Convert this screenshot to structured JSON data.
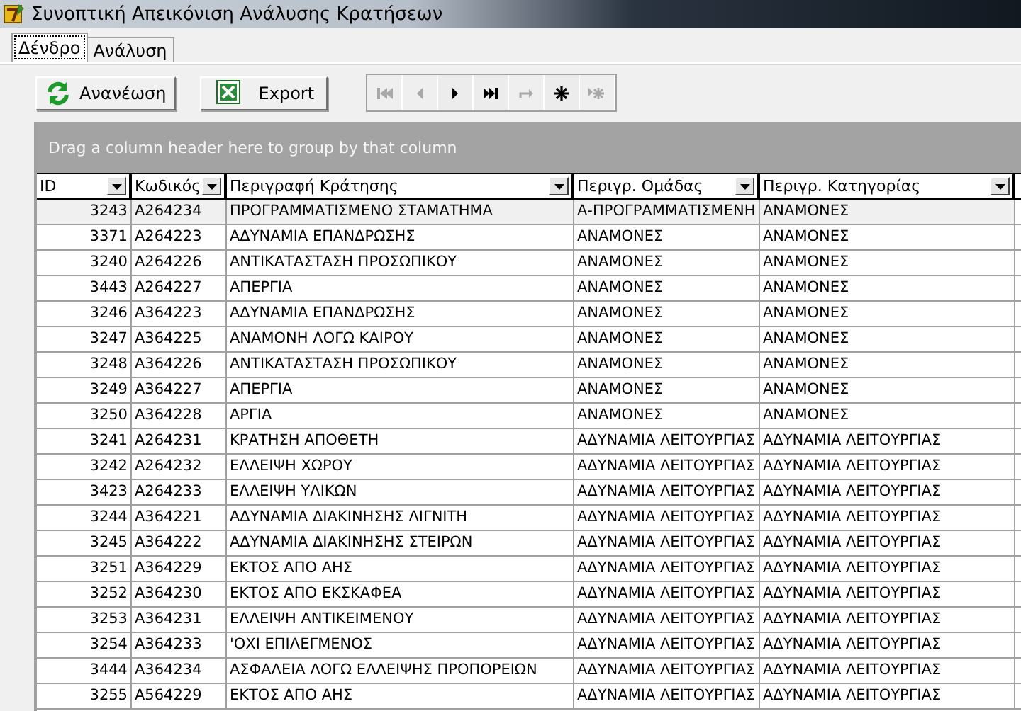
{
  "window": {
    "title": "Συνοπτική Απεικόνιση Ανάλυσης Κρατήσεων"
  },
  "tabs": [
    {
      "label": "Δένδρο",
      "selected": true
    },
    {
      "label": "Ανάλυση",
      "selected": false
    }
  ],
  "toolbar": {
    "buttons": [
      {
        "kind": "refresh",
        "label": "Ανανέωση"
      },
      {
        "kind": "export",
        "label": "Export"
      }
    ],
    "navigator": [
      {
        "kind": "first",
        "disabled": true
      },
      {
        "kind": "prev",
        "disabled": true
      },
      {
        "kind": "next",
        "disabled": false
      },
      {
        "kind": "last",
        "disabled": false
      },
      {
        "kind": "refresh",
        "disabled": true
      },
      {
        "kind": "insert",
        "disabled": false
      },
      {
        "kind": "post",
        "disabled": true
      }
    ]
  },
  "grid": {
    "group_hint": "Drag a column header here to group by that column",
    "columns": [
      "ID",
      "Κωδικός",
      "Περιγραφή Κράτησης",
      "Περιγρ. Ομάδας",
      "Περιγρ. Κατηγορίας"
    ],
    "rows": [
      {
        "selected": true,
        "cells": [
          "3243",
          "A264234",
          "ΠΡΟΓΡΑΜΜΑΤΙΣΜΕΝΟ ΣΤΑΜΑΤΗΜΑ",
          "Α-ΠΡΟΓΡΑΜΜΑΤΙΣΜΕΝΗ",
          "ΑΝΑΜΟΝΕΣ"
        ]
      },
      {
        "selected": false,
        "cells": [
          "3371",
          "A264223",
          "ΑΔΥΝΑΜΙΑ ΕΠΑΝΔΡΩΣΗΣ",
          "ΑΝΑΜΟΝΕΣ",
          "ΑΝΑΜΟΝΕΣ"
        ]
      },
      {
        "selected": false,
        "cells": [
          "3240",
          "A264226",
          "ΑΝΤΙΚΑΤΑΣΤΑΣΗ ΠΡΟΣΩΠΙΚΟΥ",
          "ΑΝΑΜΟΝΕΣ",
          "ΑΝΑΜΟΝΕΣ"
        ]
      },
      {
        "selected": false,
        "cells": [
          "3443",
          "A264227",
          "ΑΠΕΡΓΙΑ",
          "ΑΝΑΜΟΝΕΣ",
          "ΑΝΑΜΟΝΕΣ"
        ]
      },
      {
        "selected": false,
        "cells": [
          "3246",
          "A364223",
          "ΑΔΥΝΑΜΙΑ ΕΠΑΝΔΡΩΣΗΣ",
          "ΑΝΑΜΟΝΕΣ",
          "ΑΝΑΜΟΝΕΣ"
        ]
      },
      {
        "selected": false,
        "cells": [
          "3247",
          "A364225",
          "ΑΝΑΜΟΝΗ ΛΟΓΩ ΚΑΙΡΟΥ",
          "ΑΝΑΜΟΝΕΣ",
          "ΑΝΑΜΟΝΕΣ"
        ]
      },
      {
        "selected": false,
        "cells": [
          "3248",
          "A364226",
          "ΑΝΤΙΚΑΤΑΣΤΑΣΗ ΠΡΟΣΩΠΙΚΟΥ",
          "ΑΝΑΜΟΝΕΣ",
          "ΑΝΑΜΟΝΕΣ"
        ]
      },
      {
        "selected": false,
        "cells": [
          "3249",
          "A364227",
          "ΑΠΕΡΓΙΑ",
          "ΑΝΑΜΟΝΕΣ",
          "ΑΝΑΜΟΝΕΣ"
        ]
      },
      {
        "selected": false,
        "cells": [
          "3250",
          "A364228",
          "ΑΡΓΙΑ",
          "ΑΝΑΜΟΝΕΣ",
          "ΑΝΑΜΟΝΕΣ"
        ]
      },
      {
        "selected": false,
        "cells": [
          "3241",
          "A264231",
          "ΚΡΑΤΗΣΗ ΑΠΟΘΕΤΗ",
          "ΑΔΥΝΑΜΙΑ ΛΕΙΤΟΥΡΓΙΑΣ",
          "ΑΔΥΝΑΜΙΑ ΛΕΙΤΟΥΡΓΙΑΣ"
        ]
      },
      {
        "selected": false,
        "cells": [
          "3242",
          "A264232",
          "ΕΛΛΕΙΨΗ ΧΩΡΟΥ",
          "ΑΔΥΝΑΜΙΑ ΛΕΙΤΟΥΡΓΙΑΣ",
          "ΑΔΥΝΑΜΙΑ ΛΕΙΤΟΥΡΓΙΑΣ"
        ]
      },
      {
        "selected": false,
        "cells": [
          "3423",
          "A264233",
          "ΕΛΛΕΙΨΗ ΥΛΙΚΩΝ",
          "ΑΔΥΝΑΜΙΑ ΛΕΙΤΟΥΡΓΙΑΣ",
          "ΑΔΥΝΑΜΙΑ ΛΕΙΤΟΥΡΓΙΑΣ"
        ]
      },
      {
        "selected": false,
        "cells": [
          "3244",
          "A364221",
          "ΑΔΥΝΑΜΙΑ ΔΙΑΚΙΝΗΣΗΣ ΛΙΓΝΙΤΗ",
          "ΑΔΥΝΑΜΙΑ ΛΕΙΤΟΥΡΓΙΑΣ",
          "ΑΔΥΝΑΜΙΑ ΛΕΙΤΟΥΡΓΙΑΣ"
        ]
      },
      {
        "selected": false,
        "cells": [
          "3245",
          "A364222",
          "ΑΔΥΝΑΜΙΑ ΔΙΑΚΙΝΗΣΗΣ ΣΤΕΙΡΩΝ",
          "ΑΔΥΝΑΜΙΑ ΛΕΙΤΟΥΡΓΙΑΣ",
          "ΑΔΥΝΑΜΙΑ ΛΕΙΤΟΥΡΓΙΑΣ"
        ]
      },
      {
        "selected": false,
        "cells": [
          "3251",
          "A364229",
          "ΕΚΤΟΣ ΑΠΟ ΑΗΣ",
          "ΑΔΥΝΑΜΙΑ ΛΕΙΤΟΥΡΓΙΑΣ",
          "ΑΔΥΝΑΜΙΑ ΛΕΙΤΟΥΡΓΙΑΣ"
        ]
      },
      {
        "selected": false,
        "cells": [
          "3252",
          "A364230",
          "ΕΚΤΟΣ ΑΠΟ ΕΚΣΚΑΦΕΑ",
          "ΑΔΥΝΑΜΙΑ ΛΕΙΤΟΥΡΓΙΑΣ",
          "ΑΔΥΝΑΜΙΑ ΛΕΙΤΟΥΡΓΙΑΣ"
        ]
      },
      {
        "selected": false,
        "cells": [
          "3253",
          "A364231",
          "ΕΛΛΕΙΨΗ ΑΝΤΙΚΕΙΜΕΝΟΥ",
          "ΑΔΥΝΑΜΙΑ ΛΕΙΤΟΥΡΓΙΑΣ",
          "ΑΔΥΝΑΜΙΑ ΛΕΙΤΟΥΡΓΙΑΣ"
        ]
      },
      {
        "selected": false,
        "cells": [
          "3254",
          "A364233",
          "'ΟΧΙ ΕΠΙΛΕΓΜΕΝΟΣ",
          "ΑΔΥΝΑΜΙΑ ΛΕΙΤΟΥΡΓΙΑΣ",
          "ΑΔΥΝΑΜΙΑ ΛΕΙΤΟΥΡΓΙΑΣ"
        ]
      },
      {
        "selected": false,
        "cells": [
          "3444",
          "A364234",
          "ΑΣΦΑΛΕΙΑ ΛΟΓΩ ΕΛΛΕΙΨΗΣ ΠΡΟΠΟΡΕΙΩΝ",
          "ΑΔΥΝΑΜΙΑ ΛΕΙΤΟΥΡΓΙΑΣ",
          "ΑΔΥΝΑΜΙΑ ΛΕΙΤΟΥΡΓΙΑΣ"
        ]
      },
      {
        "selected": false,
        "cells": [
          "3255",
          "A564229",
          "ΕΚΤΟΣ ΑΠΟ ΑΗΣ",
          "ΑΔΥΝΑΜΙΑ ΛΕΙΤΟΥΡΓΙΑΣ",
          "ΑΔΥΝΑΜΙΑ ΛΕΙΤΟΥΡΓΙΑΣ"
        ]
      }
    ]
  }
}
